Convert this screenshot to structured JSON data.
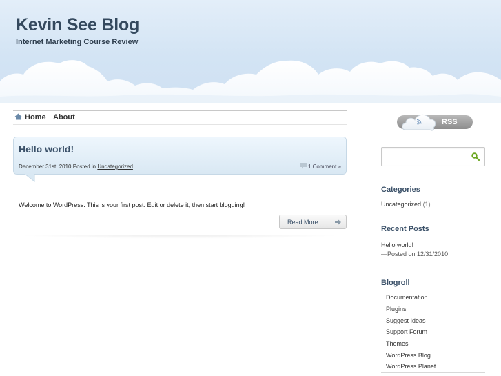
{
  "site": {
    "title": "Kevin See Blog",
    "description": "Internet Marketing Course Review"
  },
  "nav": {
    "items": [
      {
        "label": "Home",
        "icon": "home-icon"
      },
      {
        "label": "About"
      }
    ]
  },
  "post": {
    "title": "Hello world!",
    "date": "December 31st, 2010",
    "posted_in_label": "Posted in",
    "category": "Uncategorized",
    "comments": "1 Comment »",
    "body": "Welcome to WordPress. This is your first post. Edit or delete it, then start blogging!",
    "read_more": "Read More"
  },
  "sidebar": {
    "rss_label": "RSS",
    "search": {
      "placeholder": "",
      "value": ""
    },
    "categories": {
      "title": "Categories",
      "items": [
        {
          "label": "Uncategorized",
          "count": "(1)"
        }
      ]
    },
    "recent_posts": {
      "title": "Recent Posts",
      "items": [
        {
          "label": "Hello world!",
          "date": "—Posted on 12/31/2010"
        }
      ]
    },
    "blogroll": {
      "title": "Blogroll",
      "items": [
        "Documentation",
        "Plugins",
        "Suggest Ideas",
        "Support Forum",
        "Themes",
        "WordPress Blog",
        "WordPress Planet"
      ]
    }
  },
  "colors": {
    "sky": "#d3e4f4",
    "title": "#34495e",
    "accent": "#3a5068"
  }
}
